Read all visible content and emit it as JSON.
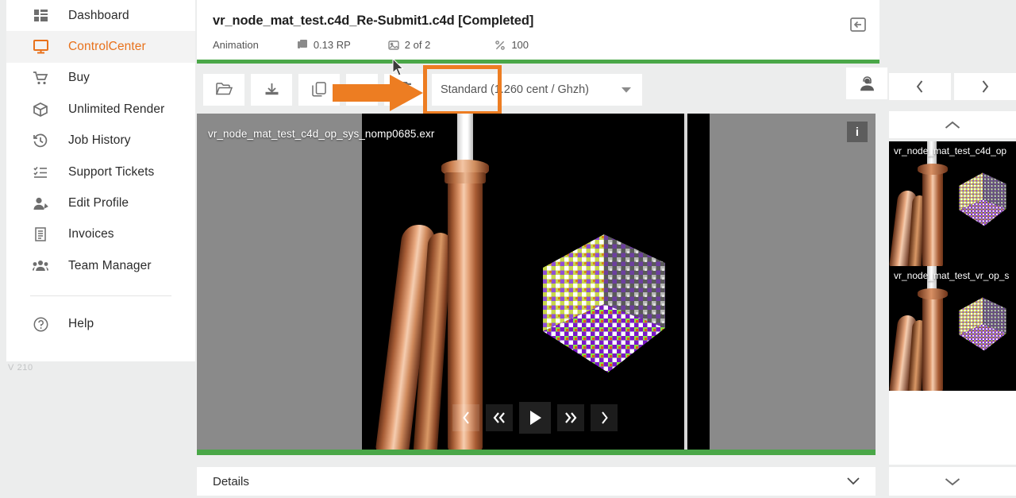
{
  "sidebar": {
    "items": [
      {
        "label": "Dashboard",
        "icon": "dashboard-icon",
        "active": false
      },
      {
        "label": "ControlCenter",
        "icon": "monitor-icon",
        "active": true
      },
      {
        "label": "Buy",
        "icon": "cart-icon",
        "active": false
      },
      {
        "label": "Unlimited Render",
        "icon": "box-icon",
        "active": false
      },
      {
        "label": "Job History",
        "icon": "history-icon",
        "active": false
      },
      {
        "label": "Support Tickets",
        "icon": "list-icon",
        "active": false
      },
      {
        "label": "Edit Profile",
        "icon": "user-edit-icon",
        "active": false
      },
      {
        "label": "Invoices",
        "icon": "invoice-icon",
        "active": false
      },
      {
        "label": "Team Manager",
        "icon": "team-icon",
        "active": false
      }
    ],
    "help_label": "Help",
    "help_icon": "question-circle-icon",
    "version": "V 210"
  },
  "header": {
    "title": "vr_node_mat_test.c4d_Re-Submit1.c4d [Completed]",
    "job_type": "Animation",
    "rp_value": "0.13 RP",
    "frames": "2 of 2",
    "percent_symbol": "%",
    "percent": "100",
    "collapse_icon": "collapse-panel-icon",
    "status_color": "#4aa748"
  },
  "toolbar": {
    "buttons": [
      {
        "name": "open-folder-button",
        "icon": "folder-open-icon"
      },
      {
        "name": "download-button",
        "icon": "download-icon"
      },
      {
        "name": "copy-button",
        "icon": "copy-icon"
      },
      {
        "name": "swap-button",
        "icon": "swap-arrows-icon"
      },
      {
        "name": "delete-button",
        "icon": "trash-icon"
      }
    ],
    "select_label": "Standard (1.260 cent / Ghzh)",
    "select_caret_icon": "chevron-down-icon",
    "support_icon": "headset-user-icon",
    "highlight_color": "#ed7d22"
  },
  "viewer": {
    "filename": "vr_node_mat_test_c4d_op_sys_nomp0685.exr",
    "info_icon": "info-icon",
    "info_label": "i",
    "playback": [
      {
        "name": "previous-frame-button",
        "icon": "chevron-left-icon",
        "glyph": "‹"
      },
      {
        "name": "fast-rewind-button",
        "icon": "double-chevron-left-icon",
        "glyph": "«"
      },
      {
        "name": "play-button",
        "icon": "play-icon",
        "glyph": "▶"
      },
      {
        "name": "fast-forward-button",
        "icon": "double-chevron-right-icon",
        "glyph": "»"
      },
      {
        "name": "next-frame-button",
        "icon": "chevron-right-icon",
        "glyph": "›"
      }
    ]
  },
  "details": {
    "label": "Details",
    "caret_icon": "chevron-down-icon"
  },
  "right_panel": {
    "prev_label": "‹",
    "next_label": "›",
    "scroll_up_icon": "chevron-up-icon",
    "scroll_down_icon": "chevron-down-icon",
    "thumbnails": [
      {
        "label": "vr_node_mat_test_c4d_op"
      },
      {
        "label": "vr_node_mat_test_vr_op_s"
      }
    ]
  }
}
